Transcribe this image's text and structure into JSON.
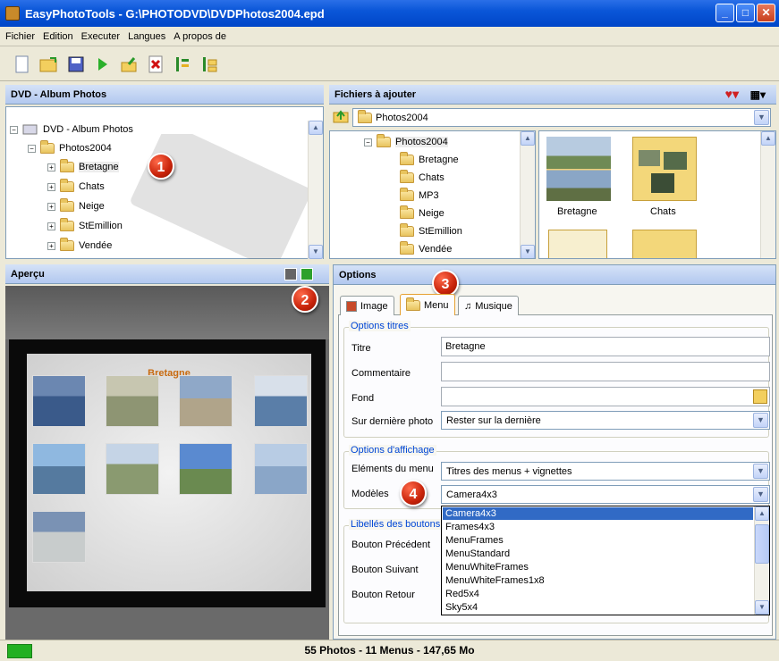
{
  "window": {
    "title": "EasyPhotoTools - G:\\PHOTODVD\\DVDPhotos2004.epd"
  },
  "menubar": [
    "Fichier",
    "Edition",
    "Executer",
    "Langues",
    "A propos de"
  ],
  "left_panel": {
    "title": "DVD - Album Photos",
    "tree": {
      "root": "DVD - Album Photos",
      "folder": "Photos2004",
      "children": [
        "Bretagne",
        "Chats",
        "Neige",
        "StEmillion",
        "Vendée"
      ]
    }
  },
  "right_panel": {
    "title": "Fichiers à ajouter",
    "path_combo": "Photos2004",
    "tree": {
      "folder": "Photos2004",
      "children": [
        "Bretagne",
        "Chats",
        "MP3",
        "Neige",
        "StEmillion",
        "Vendée"
      ]
    },
    "thumbs": [
      "Bretagne",
      "Chats"
    ]
  },
  "preview": {
    "title": "Aperçu",
    "menu_title": "Bretagne"
  },
  "options": {
    "title": "Options",
    "tabs": [
      "Image",
      "Menu",
      "Musique"
    ],
    "group_titles": "Options titres",
    "titre_label": "Titre",
    "titre_value": "Bretagne",
    "commentaire_label": "Commentaire",
    "commentaire_value": "",
    "fond_label": "Fond",
    "fond_value": "",
    "derniere_label": "Sur dernière photo",
    "derniere_value": "Rester sur la dernière",
    "group_affichage": "Options d'affichage",
    "elements_label": "Eléments du menu",
    "elements_value": "Titres des menus + vignettes",
    "modeles_label": "Modèles",
    "modeles_value": "Camera4x3",
    "modeles_options": [
      "Camera4x3",
      "Frames4x3",
      "MenuFrames",
      "MenuStandard",
      "MenuWhiteFrames",
      "MenuWhiteFrames1x8",
      "Red5x4",
      "Sky5x4"
    ],
    "group_libelles": "Libellés des boutons",
    "btn_prec": "Bouton Précédent",
    "btn_suiv": "Bouton Suivant",
    "btn_retour": "Bouton Retour"
  },
  "badges": [
    "1",
    "2",
    "3",
    "4"
  ],
  "status": {
    "text": "55 Photos - 11 Menus - 147,65 Mo"
  },
  "colors": {
    "header": "#b2c8ef",
    "titlebar": "#0a56d8",
    "badge": "#c8230a",
    "selection": "#316ac5"
  }
}
